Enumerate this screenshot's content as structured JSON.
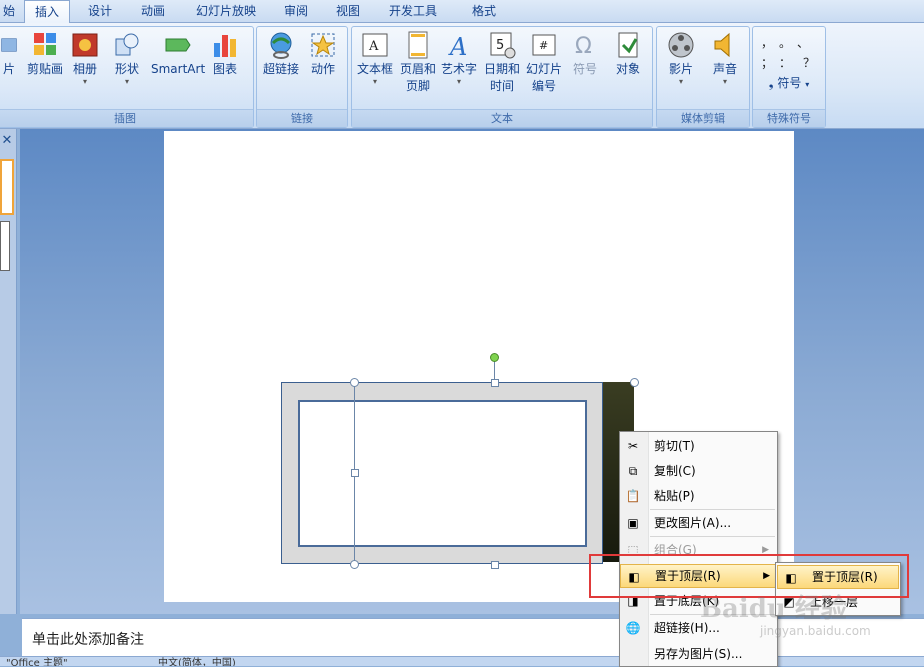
{
  "tabs": [
    {
      "label": "插入",
      "active": true
    },
    {
      "label": "设计"
    },
    {
      "label": "动画"
    },
    {
      "label": "幻灯片放映"
    },
    {
      "label": "审阅"
    },
    {
      "label": "视图"
    },
    {
      "label": "开发工具"
    },
    {
      "label": "格式"
    }
  ],
  "tab_fragment": "始",
  "ribbon": {
    "groups": {
      "illustrations": "插图",
      "links": "链接",
      "text": "文本",
      "media": "媒体剪辑",
      "special": "特殊符号"
    },
    "buttons": {
      "picture": "片",
      "clipart": "剪贴画",
      "album": "相册",
      "shapes": "形状",
      "smartart": "SmartArt",
      "chart": "图表",
      "hyperlink": "超链接",
      "action": "动作",
      "textbox": "文本框",
      "header_footer_1": "页眉和",
      "header_footer_2": "页脚",
      "wordart": "艺术字",
      "datetime_1": "日期和",
      "datetime_2": "时间",
      "slide_number_1": "幻灯片",
      "slide_number_2": "编号",
      "symbol": "符号",
      "object": "对象",
      "movie": "影片",
      "sound": "声音",
      "special_symbol": "符号"
    }
  },
  "context_menu": {
    "items": [
      {
        "label": "剪切(T)",
        "icon": "scissors-icon"
      },
      {
        "label": "复制(C)",
        "icon": "copy-icon"
      },
      {
        "label": "粘贴(P)",
        "icon": "paste-icon"
      },
      {
        "label": "更改图片(A)...",
        "icon": "change-picture-icon"
      },
      {
        "label": "组合(G)",
        "icon": "group-icon",
        "disabled": true
      },
      {
        "label": "置于顶层(R)",
        "icon": "bring-to-front-icon",
        "highlighted": true
      },
      {
        "label": "置于底层(K)",
        "icon": "send-to-back-icon"
      },
      {
        "label": "超链接(H)...",
        "icon": "hyperlink-icon"
      },
      {
        "label": "另存为图片(S)...",
        "icon": "save-as-picture-icon"
      }
    ]
  },
  "submenu": {
    "items": [
      {
        "label": "置于顶层(R)",
        "highlighted": true
      },
      {
        "label": "上移一层"
      }
    ]
  },
  "notes_placeholder": "单击此处添加备注",
  "status": {
    "theme": "\"Office 主题\"",
    "language": "中文(简体，中国)"
  },
  "watermark": {
    "brand": "Baidu 经验",
    "url": "jingyan.baidu.com"
  },
  "colors": {
    "highlight": "#fcd87a",
    "red_box": "#e03a3a",
    "ribbon_text": "#15428b"
  }
}
